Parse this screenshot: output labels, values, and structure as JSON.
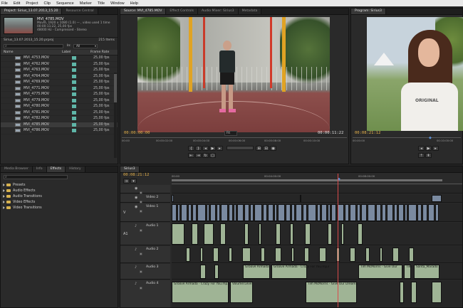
{
  "menu": [
    "File",
    "Edit",
    "Project",
    "Clip",
    "Sequence",
    "Marker",
    "Title",
    "Window",
    "Help"
  ],
  "project_panel": {
    "tabs": [
      "Project: Sirius_13.07.2013_15.20",
      "Resource Central"
    ],
    "clip_name": "MVI_4785.MOV",
    "clip_info": [
      "Movie, 1920 x 1080 (1.0) — , video used 1 time",
      "00:00:11;22, 25,00 fps",
      "48000 Hz - Compressed - Stereo"
    ],
    "project_file": "Sirius_13.07.2013_15.20.prproj",
    "item_count": "215 Items",
    "in_label": "In:",
    "in_value": "All",
    "columns": [
      "Name",
      "Label",
      "Frame Rate"
    ],
    "rows": [
      {
        "name": "MVI_4753.MOV",
        "fps": "25,00 fps"
      },
      {
        "name": "MVI_4762.MOV",
        "fps": "25,00 fps"
      },
      {
        "name": "MVI_4763.MOV",
        "fps": "25,00 fps"
      },
      {
        "name": "MVI_4764.MOV",
        "fps": "25,00 fps"
      },
      {
        "name": "MVI_4769.MOV",
        "fps": "25,00 fps"
      },
      {
        "name": "MVI_4771.MOV",
        "fps": "25,00 fps"
      },
      {
        "name": "MVI_4775.MOV",
        "fps": "25,00 fps"
      },
      {
        "name": "MVI_4779.MOV",
        "fps": "25,00 fps"
      },
      {
        "name": "MVI_4780.MOV",
        "fps": "25,00 fps"
      },
      {
        "name": "MVI_4781.MOV",
        "fps": "25,00 fps"
      },
      {
        "name": "MVI_4782.MOV",
        "fps": "25,00 fps"
      },
      {
        "name": "MVI_4785.MOV",
        "fps": "25,00 fps"
      },
      {
        "name": "MVI_4786.MOV",
        "fps": "25,00 fps"
      }
    ],
    "selected_index": 11
  },
  "source_monitor": {
    "tabs": [
      "Source: MVI_4785.MOV",
      "Effect Controls",
      "Audio Mixer: Sirius3",
      "Metadata"
    ],
    "timecode_left": "00:00:00:00",
    "fit": "Fit",
    "timecode_right": "00:00:11:22",
    "ruler": [
      "00:00",
      "00:00:02:00",
      "00:00:04:00",
      "00:00:06:00",
      "00:00:08:00",
      "00:00:10:00"
    ]
  },
  "program_monitor": {
    "tabs": [
      "Program: Sirius3"
    ],
    "timecode_left": "00:08:21:12",
    "ruler": [
      "00:00:00",
      "00:10:00:00"
    ],
    "shirt_text": "ORIGINAL"
  },
  "effects_panel": {
    "tabs": [
      "Media Browser",
      "Info",
      "Effects",
      "History"
    ],
    "items": [
      "Presets",
      "Audio Effects",
      "Audio Transitions",
      "Video Effects",
      "Video Transitions"
    ]
  },
  "timeline": {
    "tabs": [
      "Sirius3"
    ],
    "timecode": "00:08:21:12",
    "ruler": [
      "00:00",
      "00:04:00:00",
      "00:08:00:00"
    ],
    "tracks": [
      {
        "label": "",
        "kind": "video"
      },
      {
        "label": "Video 2",
        "kind": "video"
      },
      {
        "label": "Video 1",
        "kind": "video"
      },
      {
        "label": "Audio 1",
        "kind": "audio"
      },
      {
        "label": "Audio 2",
        "kind": "audio"
      },
      {
        "label": "Audio 3",
        "kind": "audio"
      },
      {
        "label": "Audio 4",
        "kind": "audio"
      }
    ],
    "track_side_labels": {
      "v1": "V",
      "a1": "A1"
    },
    "clip_labels": {
      "a3_1": "Groove Armada - Crazy For You.mp3",
      "a3_2": "Groove Armada - Crazy For You.mp3",
      "a3_3": "Tim McMorris - Give Our",
      "a3_4": "Tim",
      "a3_5": "Santa_Marado",
      "a4_1": "Groove Armada - Crazy For You.mp3",
      "a4_2": "Volume:Level",
      "a4_3": "Tim McMorris - Give Our Dreams"
    }
  },
  "colors": {
    "accent": "#e8b34b",
    "playhead": "#d94b4b",
    "panel": "#2a2a2a",
    "audio_clip": "#9fb495",
    "video_clip": "#7a8aa0"
  }
}
